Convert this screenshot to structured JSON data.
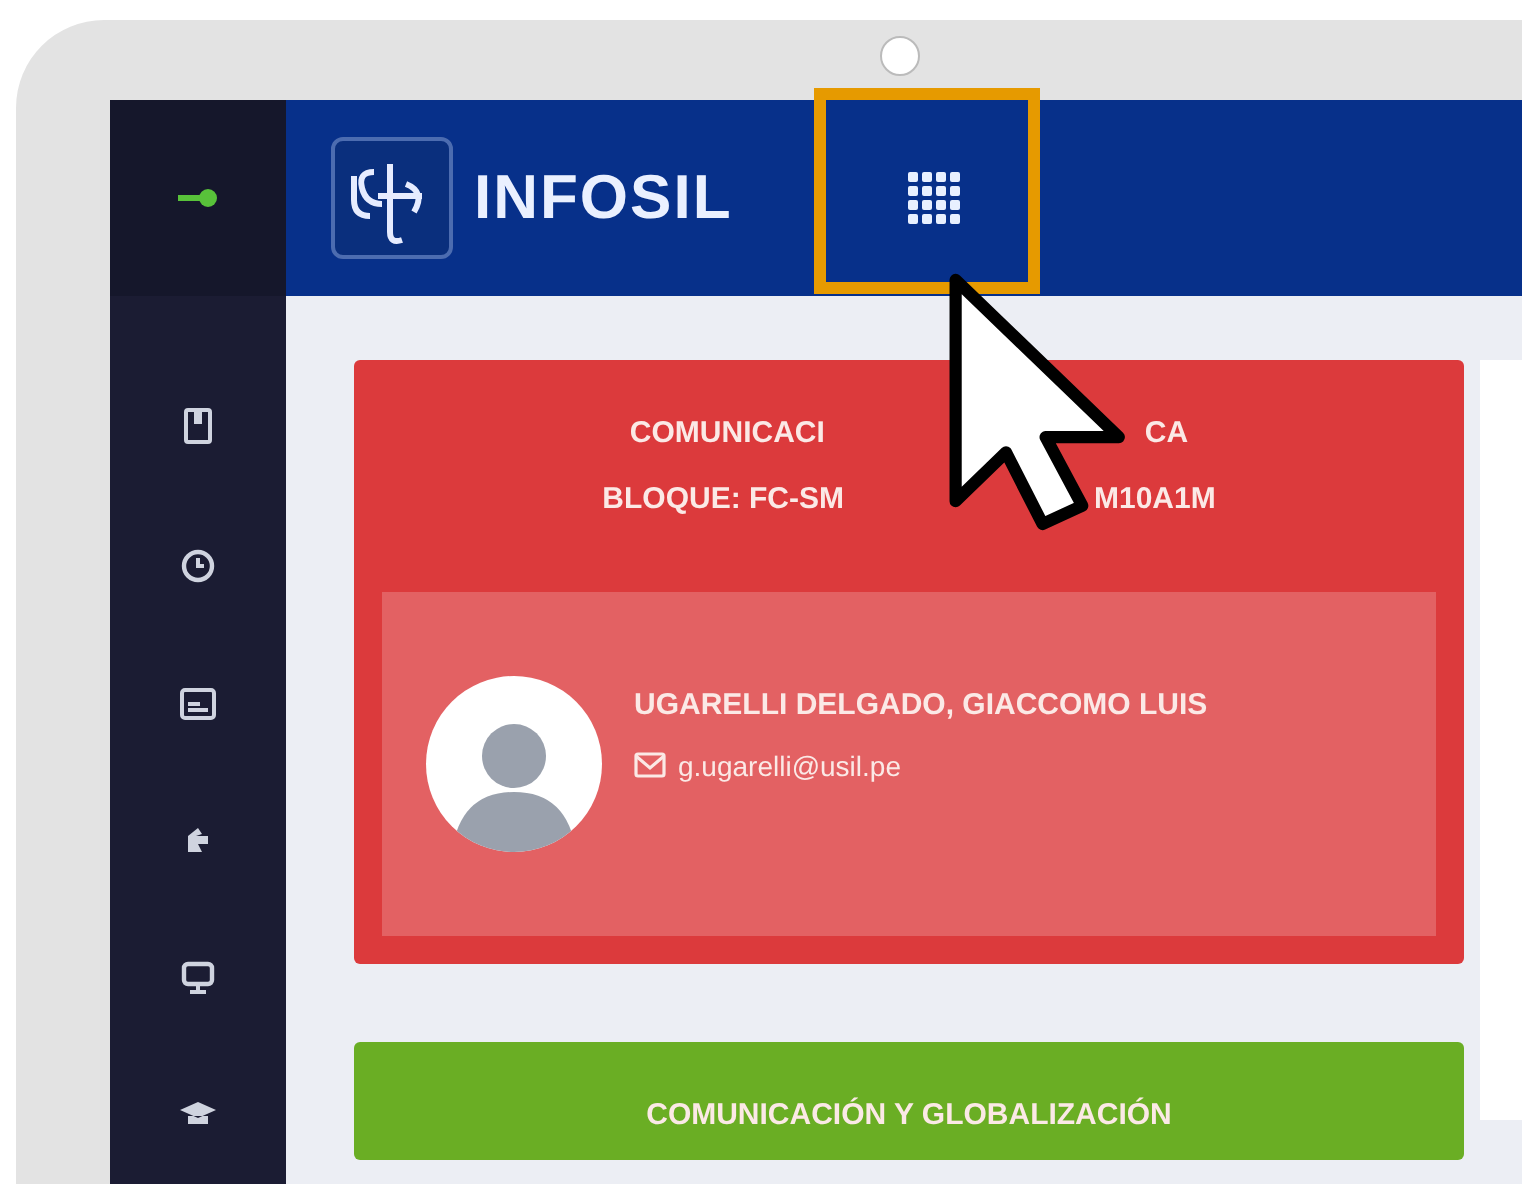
{
  "header": {
    "brand": "INFOSIL"
  },
  "courses": [
    {
      "color": "#dc3a3c",
      "title_parts": [
        "COMUNICACI",
        "CA"
      ],
      "block_parts": [
        "BLOQUE: FC-SM",
        "M10A1M"
      ],
      "teacher": {
        "name": "UGARELLI DELGADO, GIACCOMO LUIS",
        "email": "g.ugarelli@usil.pe"
      }
    },
    {
      "color": "#6aae24",
      "title_parts": [
        "COMUNICACIÓN Y GLOBALIZACIÓN"
      ]
    }
  ]
}
